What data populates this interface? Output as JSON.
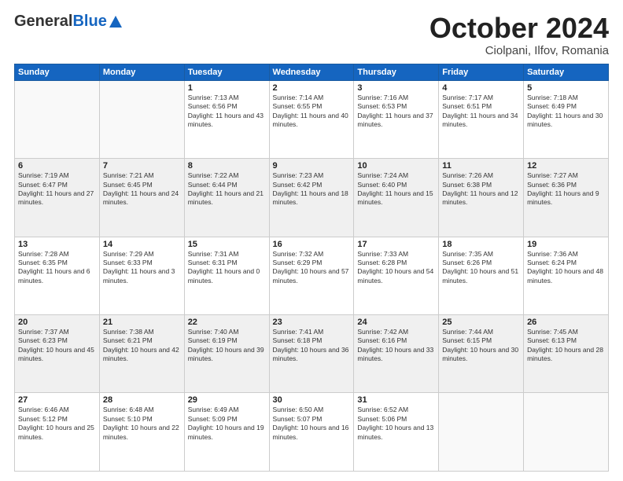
{
  "header": {
    "logo_general": "General",
    "logo_blue": "Blue",
    "title": "October 2024",
    "location": "Ciolpani, Ilfov, Romania"
  },
  "days_of_week": [
    "Sunday",
    "Monday",
    "Tuesday",
    "Wednesday",
    "Thursday",
    "Friday",
    "Saturday"
  ],
  "weeks": [
    [
      {
        "day": "",
        "info": ""
      },
      {
        "day": "",
        "info": ""
      },
      {
        "day": "1",
        "info": "Sunrise: 7:13 AM\nSunset: 6:56 PM\nDaylight: 11 hours and 43 minutes."
      },
      {
        "day": "2",
        "info": "Sunrise: 7:14 AM\nSunset: 6:55 PM\nDaylight: 11 hours and 40 minutes."
      },
      {
        "day": "3",
        "info": "Sunrise: 7:16 AM\nSunset: 6:53 PM\nDaylight: 11 hours and 37 minutes."
      },
      {
        "day": "4",
        "info": "Sunrise: 7:17 AM\nSunset: 6:51 PM\nDaylight: 11 hours and 34 minutes."
      },
      {
        "day": "5",
        "info": "Sunrise: 7:18 AM\nSunset: 6:49 PM\nDaylight: 11 hours and 30 minutes."
      }
    ],
    [
      {
        "day": "6",
        "info": "Sunrise: 7:19 AM\nSunset: 6:47 PM\nDaylight: 11 hours and 27 minutes."
      },
      {
        "day": "7",
        "info": "Sunrise: 7:21 AM\nSunset: 6:45 PM\nDaylight: 11 hours and 24 minutes."
      },
      {
        "day": "8",
        "info": "Sunrise: 7:22 AM\nSunset: 6:44 PM\nDaylight: 11 hours and 21 minutes."
      },
      {
        "day": "9",
        "info": "Sunrise: 7:23 AM\nSunset: 6:42 PM\nDaylight: 11 hours and 18 minutes."
      },
      {
        "day": "10",
        "info": "Sunrise: 7:24 AM\nSunset: 6:40 PM\nDaylight: 11 hours and 15 minutes."
      },
      {
        "day": "11",
        "info": "Sunrise: 7:26 AM\nSunset: 6:38 PM\nDaylight: 11 hours and 12 minutes."
      },
      {
        "day": "12",
        "info": "Sunrise: 7:27 AM\nSunset: 6:36 PM\nDaylight: 11 hours and 9 minutes."
      }
    ],
    [
      {
        "day": "13",
        "info": "Sunrise: 7:28 AM\nSunset: 6:35 PM\nDaylight: 11 hours and 6 minutes."
      },
      {
        "day": "14",
        "info": "Sunrise: 7:29 AM\nSunset: 6:33 PM\nDaylight: 11 hours and 3 minutes."
      },
      {
        "day": "15",
        "info": "Sunrise: 7:31 AM\nSunset: 6:31 PM\nDaylight: 11 hours and 0 minutes."
      },
      {
        "day": "16",
        "info": "Sunrise: 7:32 AM\nSunset: 6:29 PM\nDaylight: 10 hours and 57 minutes."
      },
      {
        "day": "17",
        "info": "Sunrise: 7:33 AM\nSunset: 6:28 PM\nDaylight: 10 hours and 54 minutes."
      },
      {
        "day": "18",
        "info": "Sunrise: 7:35 AM\nSunset: 6:26 PM\nDaylight: 10 hours and 51 minutes."
      },
      {
        "day": "19",
        "info": "Sunrise: 7:36 AM\nSunset: 6:24 PM\nDaylight: 10 hours and 48 minutes."
      }
    ],
    [
      {
        "day": "20",
        "info": "Sunrise: 7:37 AM\nSunset: 6:23 PM\nDaylight: 10 hours and 45 minutes."
      },
      {
        "day": "21",
        "info": "Sunrise: 7:38 AM\nSunset: 6:21 PM\nDaylight: 10 hours and 42 minutes."
      },
      {
        "day": "22",
        "info": "Sunrise: 7:40 AM\nSunset: 6:19 PM\nDaylight: 10 hours and 39 minutes."
      },
      {
        "day": "23",
        "info": "Sunrise: 7:41 AM\nSunset: 6:18 PM\nDaylight: 10 hours and 36 minutes."
      },
      {
        "day": "24",
        "info": "Sunrise: 7:42 AM\nSunset: 6:16 PM\nDaylight: 10 hours and 33 minutes."
      },
      {
        "day": "25",
        "info": "Sunrise: 7:44 AM\nSunset: 6:15 PM\nDaylight: 10 hours and 30 minutes."
      },
      {
        "day": "26",
        "info": "Sunrise: 7:45 AM\nSunset: 6:13 PM\nDaylight: 10 hours and 28 minutes."
      }
    ],
    [
      {
        "day": "27",
        "info": "Sunrise: 6:46 AM\nSunset: 5:12 PM\nDaylight: 10 hours and 25 minutes."
      },
      {
        "day": "28",
        "info": "Sunrise: 6:48 AM\nSunset: 5:10 PM\nDaylight: 10 hours and 22 minutes."
      },
      {
        "day": "29",
        "info": "Sunrise: 6:49 AM\nSunset: 5:09 PM\nDaylight: 10 hours and 19 minutes."
      },
      {
        "day": "30",
        "info": "Sunrise: 6:50 AM\nSunset: 5:07 PM\nDaylight: 10 hours and 16 minutes."
      },
      {
        "day": "31",
        "info": "Sunrise: 6:52 AM\nSunset: 5:06 PM\nDaylight: 10 hours and 13 minutes."
      },
      {
        "day": "",
        "info": ""
      },
      {
        "day": "",
        "info": ""
      }
    ]
  ]
}
